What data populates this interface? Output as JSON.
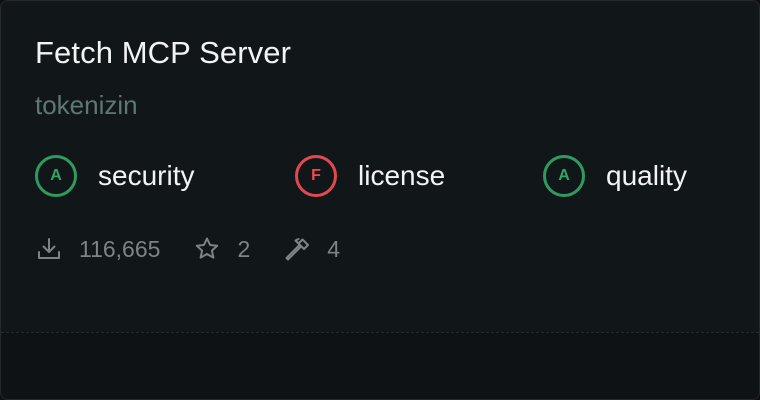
{
  "server": {
    "name": "Fetch MCP Server",
    "author": "tokenizin"
  },
  "grades": [
    {
      "grade": "A",
      "label": "security",
      "status": "pass"
    },
    {
      "grade": "F",
      "label": "license",
      "status": "fail"
    },
    {
      "grade": "A",
      "label": "quality",
      "status": "pass"
    }
  ],
  "stats": {
    "downloads": "116,665",
    "stars": "2",
    "tools": "4"
  },
  "icons": {
    "downloads": "download-icon",
    "stars": "star-icon",
    "tools": "hammer-icon"
  },
  "colors": {
    "pass": "#2f9a5e",
    "fail": "#e34850",
    "muted": "#5f7771"
  }
}
